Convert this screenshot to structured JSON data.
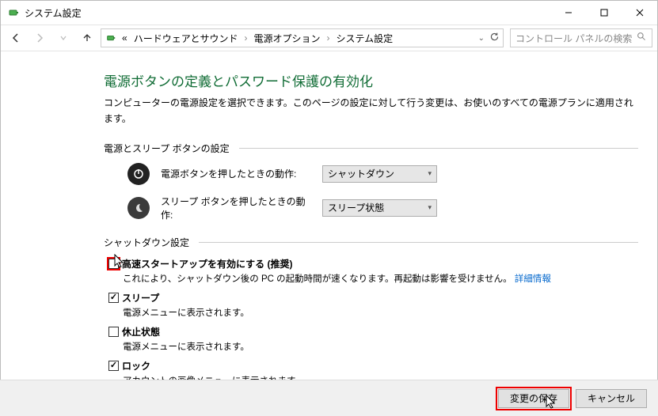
{
  "window": {
    "title": "システム設定"
  },
  "breadcrumb": {
    "parent_indicator": "«",
    "b1": "ハードウェアとサウンド",
    "b2": "電源オプション",
    "b3": "システム設定"
  },
  "search": {
    "placeholder": "コントロール パネルの検索"
  },
  "page": {
    "title": "電源ボタンの定義とパスワード保護の有効化",
    "desc": "コンピューターの電源設定を選択できます。このページの設定に対して行う変更は、お使いのすべての電源プランに適用されます。"
  },
  "section1": {
    "title": "電源とスリープ ボタンの設定",
    "power_label": "電源ボタンを押したときの動作:",
    "power_value": "シャットダウン",
    "sleep_label": "スリープ ボタンを押したときの動作:",
    "sleep_value": "スリープ状態"
  },
  "section2": {
    "title": "シャットダウン設定",
    "opt1": {
      "label": "高速スタートアップを有効にする (推奨)",
      "desc_pre": "これにより、シャットダウン後の PC の起動時間が速くなります。再起動は影響を受けません。",
      "link": "詳細情報",
      "checked": false
    },
    "opt2": {
      "label": "スリープ",
      "desc": "電源メニューに表示されます。",
      "checked": true
    },
    "opt3": {
      "label": "休止状態",
      "desc": "電源メニューに表示されます。",
      "checked": false
    },
    "opt4": {
      "label": "ロック",
      "desc": "アカウントの画像メニューに表示されます。",
      "checked": true
    }
  },
  "footer": {
    "save": "変更の保存",
    "cancel": "キャンセル"
  }
}
